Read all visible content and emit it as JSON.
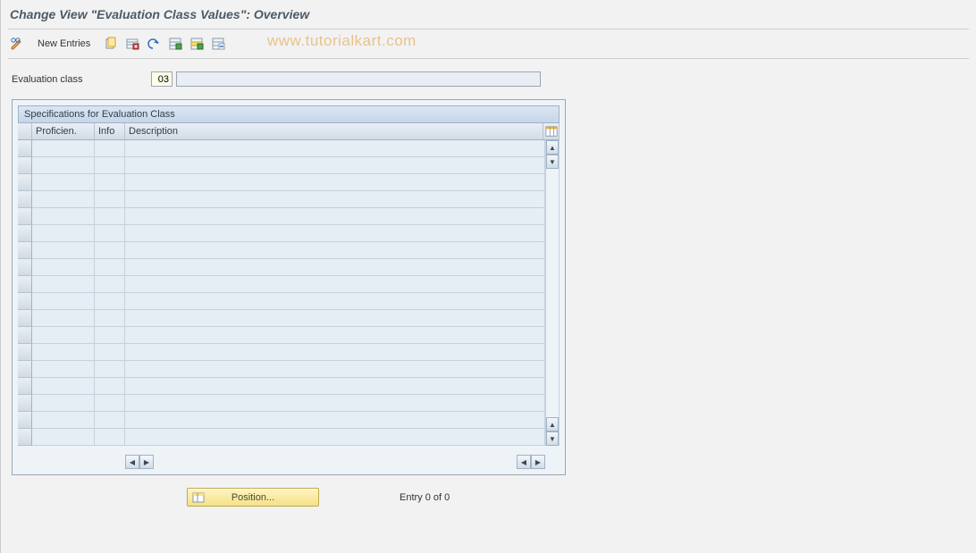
{
  "title": "Change View \"Evaluation Class Values\": Overview",
  "toolbar": {
    "new_entries": "New Entries"
  },
  "watermark": "www.tutorialkart.com",
  "form": {
    "label": "Evaluation class",
    "value": "03",
    "desc": ""
  },
  "grid": {
    "title": "Specifications for Evaluation Class",
    "columns": {
      "proficien": "Proficien.",
      "info": "Info",
      "description": "Description"
    },
    "row_count": 18
  },
  "footer": {
    "position": "Position...",
    "entry": "Entry 0 of 0"
  }
}
